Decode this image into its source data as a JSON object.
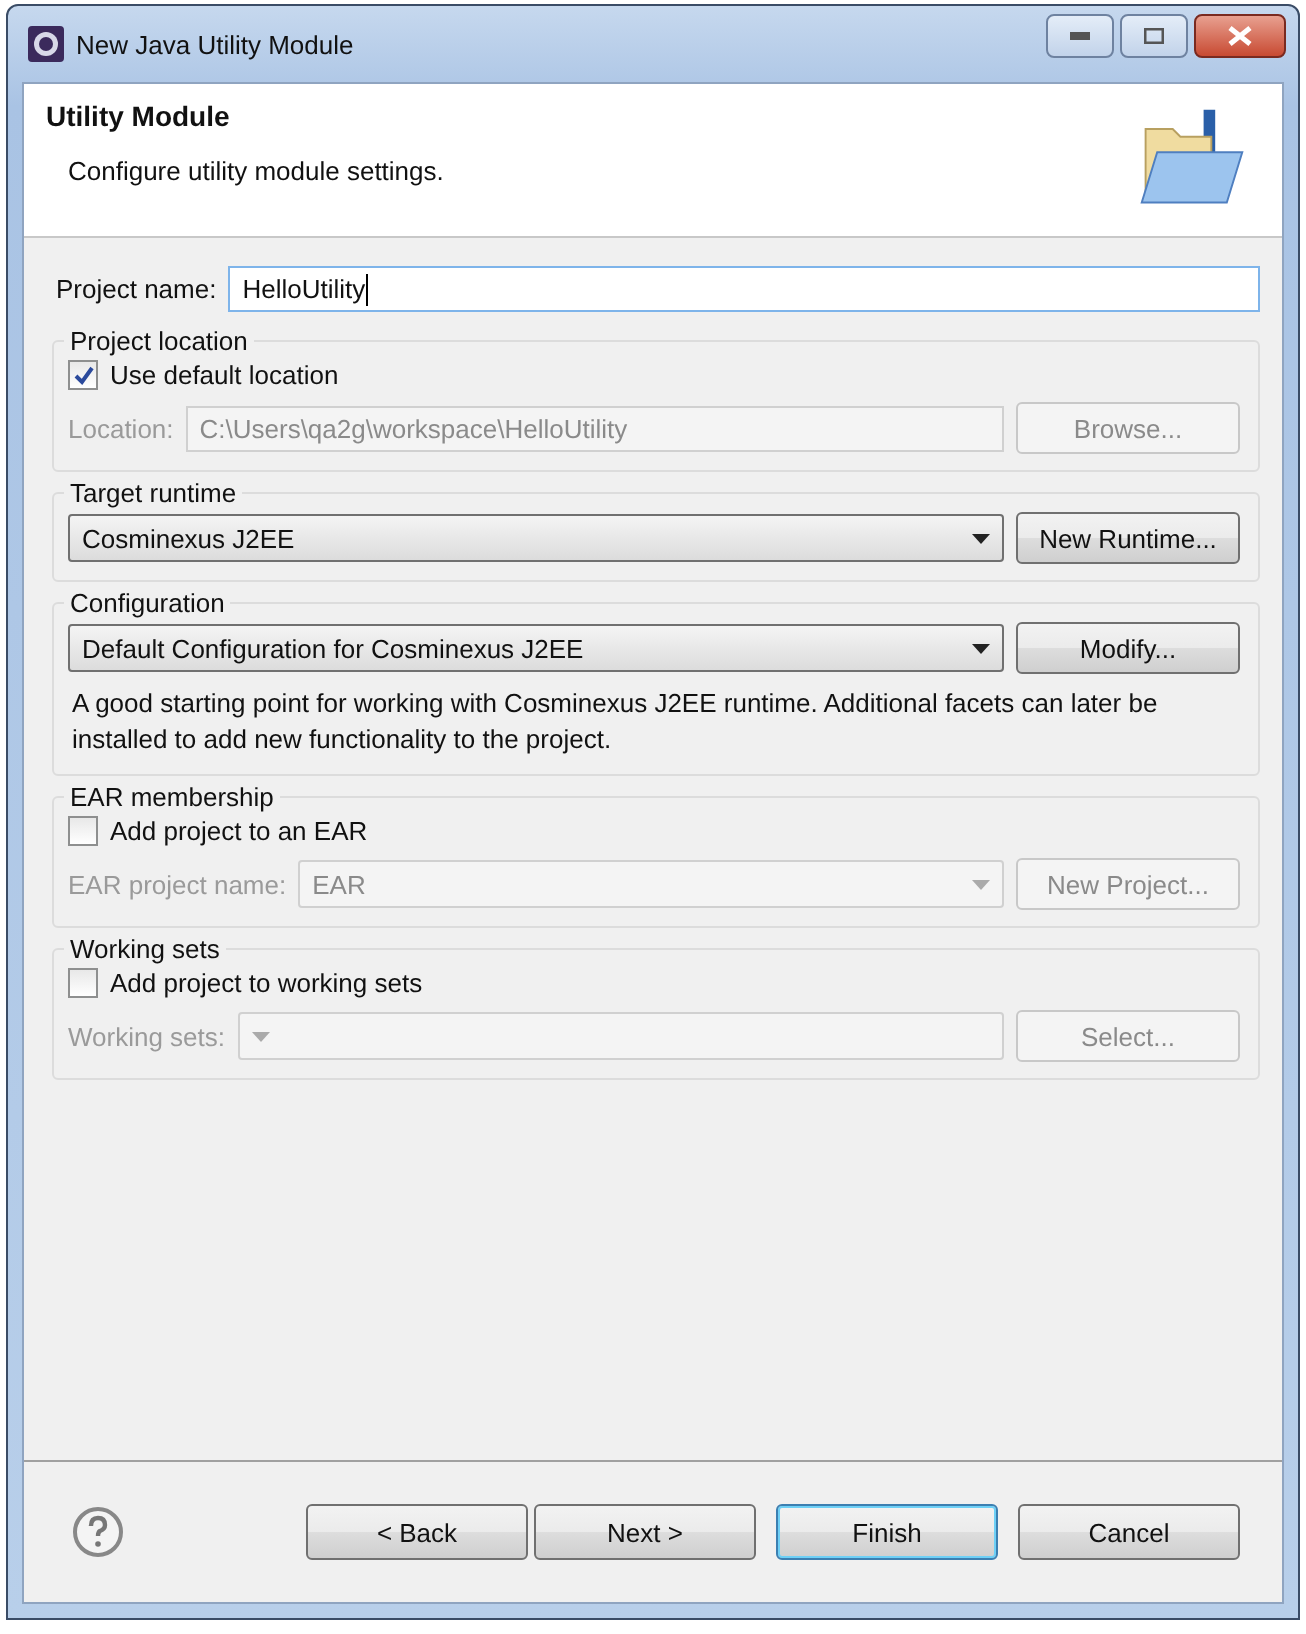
{
  "window": {
    "title": "New Java Utility Module"
  },
  "header": {
    "title": "Utility Module",
    "description": "Configure utility module settings."
  },
  "project_name": {
    "label": "Project name:",
    "value": "HelloUtility"
  },
  "groups": [
    {
      "title": "Project location",
      "rows": [
        {
          "kind": "checkbox",
          "label": "Use default location",
          "checked": true
        },
        {
          "kind": "field",
          "label": "Location:",
          "value": "C:\\Users\\qa2g\\workspace\\HelloUtility",
          "disabled": true,
          "button": {
            "label": "Browse...",
            "disabled": true
          }
        }
      ]
    },
    {
      "title": "Target runtime",
      "rows": [
        {
          "kind": "combo",
          "value": "Cosminexus J2EE",
          "disabled": false,
          "button": {
            "label": "New Runtime...",
            "disabled": false
          }
        }
      ]
    },
    {
      "title": "Configuration",
      "rows": [
        {
          "kind": "combo",
          "value": "Default Configuration for Cosminexus J2EE",
          "disabled": false,
          "button": {
            "label": "Modify...",
            "disabled": false
          }
        },
        {
          "kind": "text",
          "text": "A good starting point for working with Cosminexus J2EE runtime. Additional facets can later be installed to add new functionality to the project."
        }
      ]
    },
    {
      "title": "EAR membership",
      "rows": [
        {
          "kind": "checkbox",
          "label": "Add project to an EAR",
          "checked": false
        },
        {
          "kind": "combo",
          "label": "EAR project name:",
          "value": "EAR",
          "disabled": true,
          "button": {
            "label": "New Project...",
            "disabled": true
          }
        }
      ]
    },
    {
      "title": "Working sets",
      "rows": [
        {
          "kind": "checkbox",
          "label": "Add project to working sets",
          "checked": false
        },
        {
          "kind": "combo",
          "label": "Working sets:",
          "disabled": true,
          "button": {
            "label": "Select...",
            "disabled": true
          }
        }
      ]
    }
  ],
  "buttons": [
    {
      "label": "< Back",
      "default": false
    },
    {
      "label": "Next >",
      "default": false
    },
    {
      "label": "Finish",
      "default": true
    },
    {
      "label": "Cancel",
      "default": false
    }
  ]
}
